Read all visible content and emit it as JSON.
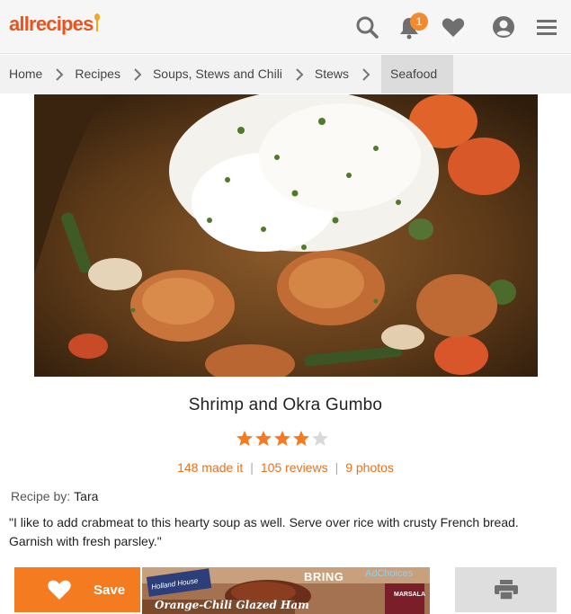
{
  "header": {
    "logo_text": "allrecipes",
    "notification_count": "1",
    "icons": [
      "search-icon",
      "bell-icon",
      "heart-icon",
      "user-icon",
      "menu-icon"
    ]
  },
  "breadcrumb": [
    "Home",
    "Recipes",
    "Soups, Stews and Chili",
    "Stews",
    "Seafood"
  ],
  "recipe": {
    "title": "Shrimp and Okra Gumbo",
    "rating": 4,
    "rating_max": 5,
    "made_it": "148 made it",
    "reviews": "105 reviews",
    "photos": "9 photos",
    "recipe_by_label": "Recipe by:",
    "author": "Tara",
    "description": "\"I like to add crabmeat to this hearty soup as well. Serve over rice with crusty French bread. Garnish with fresh parsley.\""
  },
  "actions": {
    "save_label": "Save"
  },
  "ad": {
    "brand": "Holland House",
    "headline": "BRING",
    "caption": "Orange-Chili Glazed Ham",
    "product": "MARSALA",
    "adchoices": "AdChoices"
  },
  "colors": {
    "brand_orange": "#f47b20",
    "link_orange": "#e8711e",
    "star_filled": "#f47b20",
    "star_empty": "#d9d9d9"
  }
}
